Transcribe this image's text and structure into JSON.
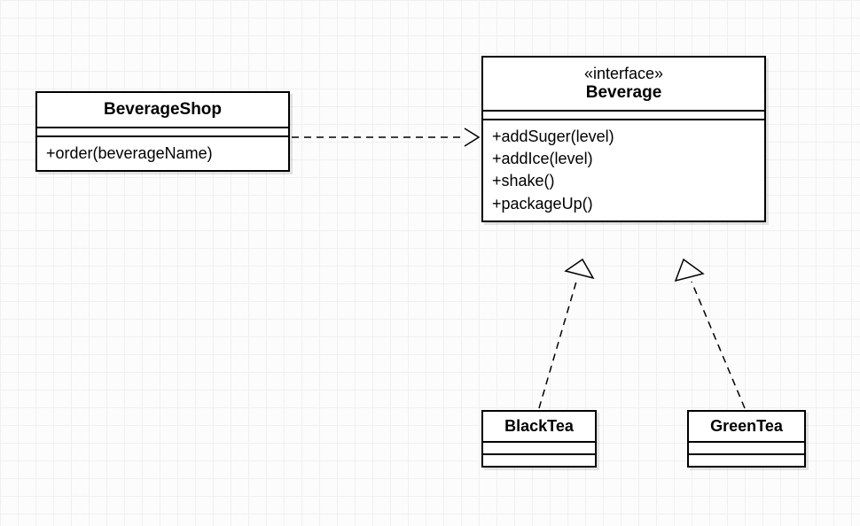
{
  "classes": {
    "beverageShop": {
      "name": "BeverageShop",
      "methods": [
        "+order(beverageName)"
      ]
    },
    "beverage": {
      "stereotype": "«interface»",
      "name": "Beverage",
      "methods": [
        "+addSuger(level)",
        "+addIce(level)",
        "+shake()",
        "+packageUp()"
      ]
    },
    "blackTea": {
      "name": "BlackTea"
    },
    "greenTea": {
      "name": "GreenTea"
    }
  }
}
